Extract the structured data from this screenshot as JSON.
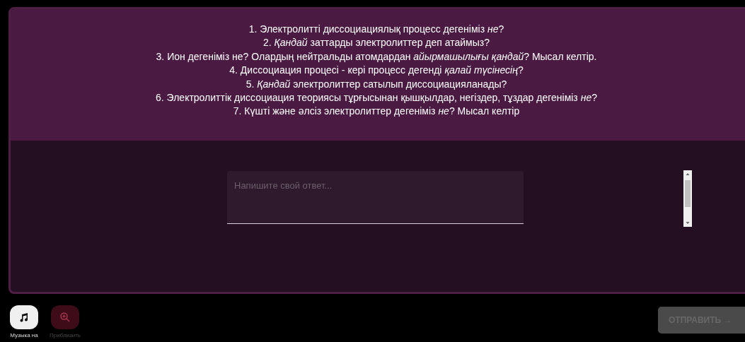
{
  "questions": [
    "1. Электролитті диссоциациялық процесс дегеніміз *не*?",
    "2. *Қандай* заттарды электролиттер деп атаймыз?",
    "3. Ион дегеніміз не? Олардың нейтральды атомдардан *айырмашылығы қандай*? Мысал келтір.",
    "4. Диссоциация процесі - кері процесс дегенді *қалай түсінесің*?",
    "5. *Қандай* электролиттер сатылып диссоциацияланады?",
    "6. Электролиттік диссоциация теориясы тұрғысынан қышқылдар, негіздер, тұздар дегеніміз *не*?",
    "7. Күшті және әлсіз электролиттер дегеніміз *не*? Мысал келтір"
  ],
  "answer": {
    "placeholder": "Напишите свой ответ..."
  },
  "tools": [
    {
      "kind": "music",
      "label": "Музыка на",
      "disabled": false
    },
    {
      "kind": "zoom",
      "label": "Приблизить",
      "disabled": true
    }
  ],
  "submit": {
    "label": "ОТПРАВИТЬ →",
    "disabled": true
  }
}
